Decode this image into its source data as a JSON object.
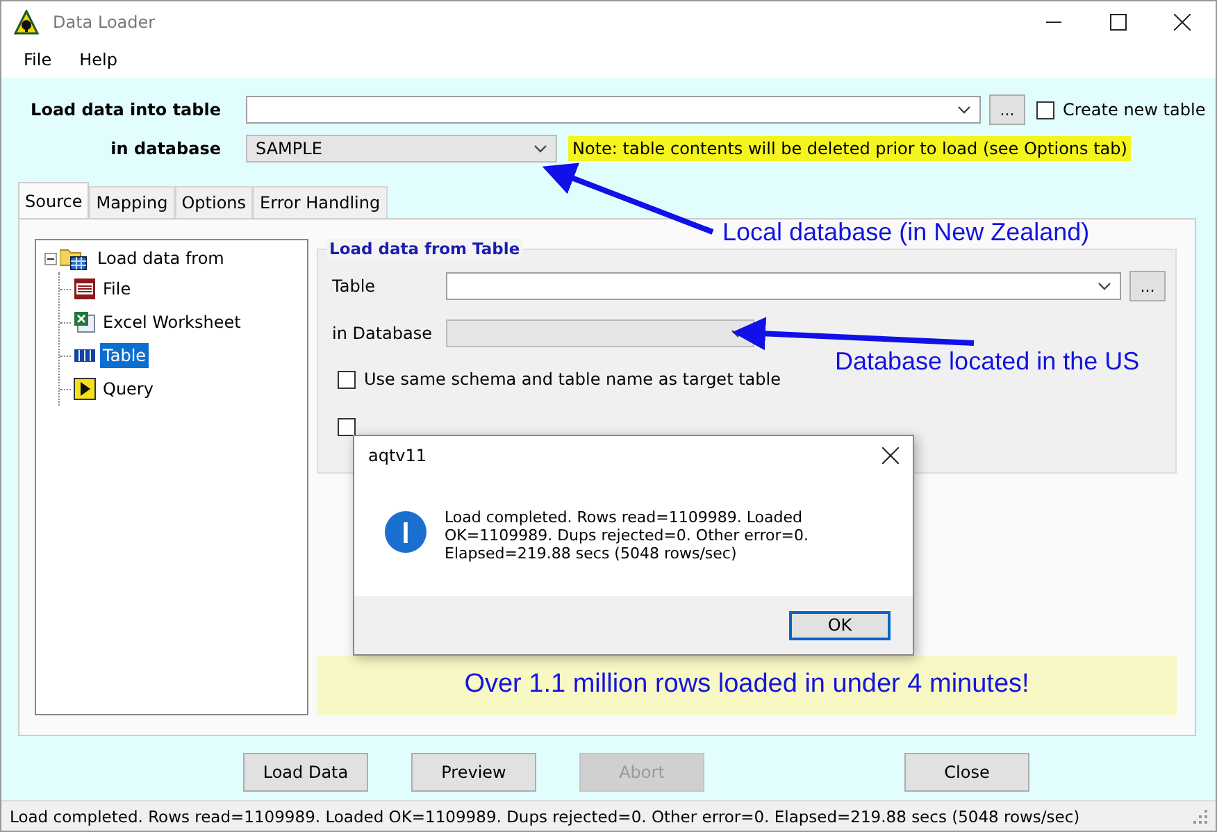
{
  "window": {
    "title": "Data Loader"
  },
  "menu": [
    "File",
    "Help"
  ],
  "target": {
    "table_label": "Load data into table",
    "browse_button": "...",
    "create_new": {
      "label": "Create new table",
      "checked": false
    },
    "database_label": "in database",
    "database": "SAMPLE",
    "note": "Note: table contents will be deleted prior to load (see Options tab)"
  },
  "tabs": [
    {
      "label": "Source",
      "selected": true
    },
    {
      "label": "Mapping",
      "selected": false
    },
    {
      "label": "Options",
      "selected": false
    },
    {
      "label": "Error Handling",
      "selected": false
    }
  ],
  "tree": {
    "label": "Load data from",
    "expanded": true,
    "children": [
      {
        "label": "File",
        "kind": "csv",
        "selected": false
      },
      {
        "label": "Excel Worksheet",
        "kind": "excel",
        "selected": false
      },
      {
        "label": "Table",
        "kind": "table",
        "selected": true
      },
      {
        "label": "Query",
        "kind": "query",
        "selected": false
      }
    ]
  },
  "source_group": {
    "title": "Load data from Table",
    "table_label": "Table",
    "browse_button": "...",
    "database_label": "in Database",
    "options": [
      {
        "label": "Use same schema and table name as target table",
        "checked": false
      },
      {
        "checked": false
      }
    ]
  },
  "annotations": [
    {
      "text": "Local database (in New Zealand)"
    },
    {
      "text": "Database located in the US"
    }
  ],
  "callout": "Over 1.1 million rows loaded in under 4 minutes!",
  "dialog": {
    "title": "aqtv11",
    "message": "Load completed. Rows read=1109989. Loaded OK=1109989. Dups rejected=0. Other error=0. Elapsed=219.88 secs (5048 rows/sec)",
    "button": "OK"
  },
  "buttons": [
    {
      "label": "Load Data",
      "disabled": false
    },
    {
      "label": "Preview",
      "disabled": false
    },
    {
      "label": "Abort",
      "disabled": true
    },
    {
      "label": "Close",
      "disabled": false
    }
  ],
  "status_bar": "Load completed. Rows read=1109989. Loaded OK=1109989. Dups rejected=0. Other error=0. Elapsed=219.88 secs (5048 rows/sec)"
}
